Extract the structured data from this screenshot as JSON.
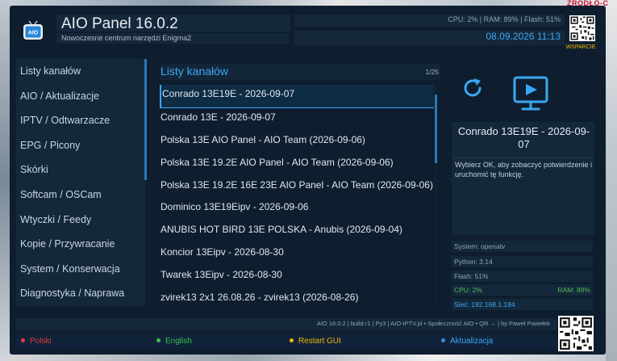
{
  "app": {
    "title": "AIO Panel 16.0.2",
    "subtitle": "Nowoczesne centrum narzędzi Enigma2",
    "icon_text": "AIO",
    "sysline": "CPU: 2%  |  RAM: 89%  |  Flash: 51%",
    "datetime": "08.09.2026  11:13",
    "support_label": "WSPARCIE",
    "corner_brand": "ZRODŁO-C"
  },
  "sidebar": {
    "items": [
      {
        "label": "Listy kanałów"
      },
      {
        "label": "AIO / Aktualizacje"
      },
      {
        "label": "IPTV / Odtwarzacze"
      },
      {
        "label": "EPG / Picony"
      },
      {
        "label": "Skórki"
      },
      {
        "label": "Softcam / OSCam"
      },
      {
        "label": "Wtyczki / Feedy"
      },
      {
        "label": "Kopie / Przywracanie"
      },
      {
        "label": "System / Konserwacja"
      },
      {
        "label": "Diagnostyka / Naprawa"
      }
    ]
  },
  "list": {
    "title": "Listy kanałów",
    "count": "1/25",
    "items": [
      {
        "label": "Conrado 13E19E - 2026-09-07",
        "selected": true
      },
      {
        "label": "Conrado 13E - 2026-09-07"
      },
      {
        "label": "Polska 13E AIO Panel - AIO Team (2026-09-06)"
      },
      {
        "label": "Polska 13E 19.2E AIO Panel - AIO Team (2026-09-06)"
      },
      {
        "label": "Polska 13E 19.2E 16E 23E AIO Panel - AIO Team (2026-09-06)"
      },
      {
        "label": "Dominico 13E19Eipv - 2026-09-06"
      },
      {
        "label": "ANUBIS HOT BIRD 13E POLSKA - Anubis (2026-09-04)"
      },
      {
        "label": "Koncior 13Eipv - 2026-08-30"
      },
      {
        "label": "Twarek 13Eipv - 2026-08-30"
      },
      {
        "label": "zvirek13 2x1 26.08.26 - zvirek13 (2026-08-26)"
      }
    ]
  },
  "info": {
    "title": "Conrado 13E19E - 2026-09-07",
    "description": "Wybierz OK, aby zobaczyć potwierdzenie i uruchomić tę funkcję.",
    "system": "System: openatv",
    "python": "Python: 3.14",
    "flash": "Flash: 51%",
    "cpu": "CPU: 2%",
    "ram": "RAM: 89%",
    "net": "Sieć: 192.168.1.184"
  },
  "footer": {
    "text": "AIO 16.0.2 | build r1 | Py3 | AIO-IPTV.pl • Społeczność AIO • QR → | by Paweł Pawełek",
    "buttons": [
      {
        "label": "Polski",
        "color": "#e23b3b"
      },
      {
        "label": "English",
        "color": "#3bbf4a"
      },
      {
        "label": "Restart GUI",
        "color": "#f2b705"
      },
      {
        "label": "Aktualizacja",
        "color": "#3a8fe0"
      }
    ]
  },
  "colors": {
    "accent": "#3aa7f3",
    "panel_bg": "#0e1e2e",
    "box_bg": "#14283b",
    "support": "#f2b705",
    "ok_green": "#4bbf55"
  }
}
